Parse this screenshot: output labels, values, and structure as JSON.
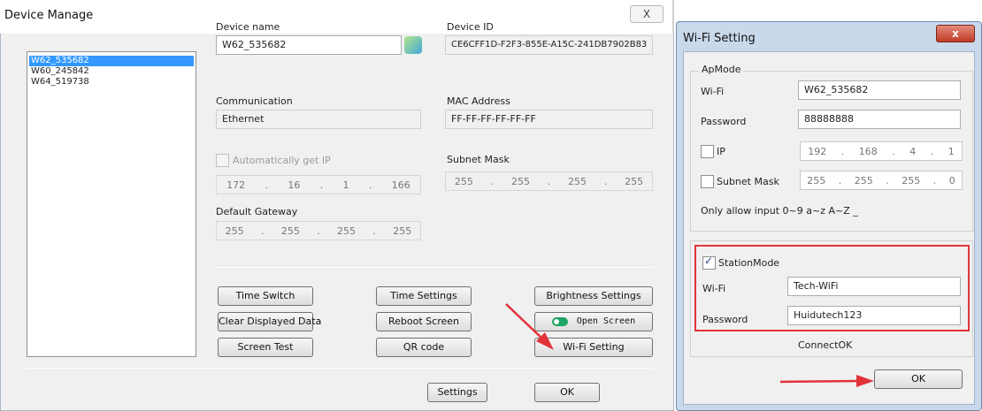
{
  "device_manage": {
    "title": "Device Manage",
    "close_glyph": "X",
    "devices": [
      "W62_535682",
      "W60_245842",
      "W64_519738"
    ],
    "labels": {
      "device_name": "Device name",
      "device_id": "Device ID",
      "communication": "Communication",
      "mac_address": "MAC Address",
      "auto_ip": "Automatically get IP",
      "subnet_mask": "Subnet Mask",
      "default_gateway": "Default Gateway"
    },
    "values": {
      "device_name": "W62_535682",
      "device_id": "CE6CFF1D-F2F3-855E-A15C-241DB7902B83",
      "communication": "Ethernet",
      "mac_address": "FF-FF-FF-FF-FF-FF",
      "ip": [
        "172",
        "16",
        "1",
        "166"
      ],
      "subnet": [
        "255",
        "255",
        "255",
        "255"
      ],
      "gateway": [
        "255",
        "255",
        "255",
        "255"
      ]
    },
    "buttons": {
      "time_switch": "Time Switch",
      "time_settings": "Time Settings",
      "brightness_settings": "Brightness Settings",
      "clear_displayed_data": "Clear Displayed Data",
      "reboot_screen": "Reboot Screen",
      "open_screen": "Open Screen",
      "screen_test": "Screen Test",
      "qr_code": "QR code",
      "wifi_setting": "Wi-Fi Setting",
      "settings": "Settings",
      "ok": "OK"
    }
  },
  "wifi_setting": {
    "title": "Wi-Fi Setting",
    "ap_mode": {
      "group_label": "ApMode",
      "wifi_label": "Wi-Fi",
      "wifi_value": "W62_535682",
      "password_label": "Password",
      "password_value": "88888888",
      "ip_label": "IP",
      "ip_value": [
        "192",
        "168",
        "4",
        "1"
      ],
      "subnet_label": "Subnet Mask",
      "subnet_value": [
        "255",
        "255",
        "255",
        "0"
      ],
      "hint": "Only allow input 0~9 a~z A~Z _"
    },
    "station_mode": {
      "label": "StationMode",
      "checked": true,
      "wifi_label": "Wi-Fi",
      "wifi_value": "Tech-WiFi",
      "password_label": "Password",
      "password_value": "Huidutech123",
      "status": "ConnectOK"
    },
    "ok_label": "OK"
  },
  "colors": {
    "annotation_red": "#e2333b",
    "selection_blue": "#3399ff"
  }
}
